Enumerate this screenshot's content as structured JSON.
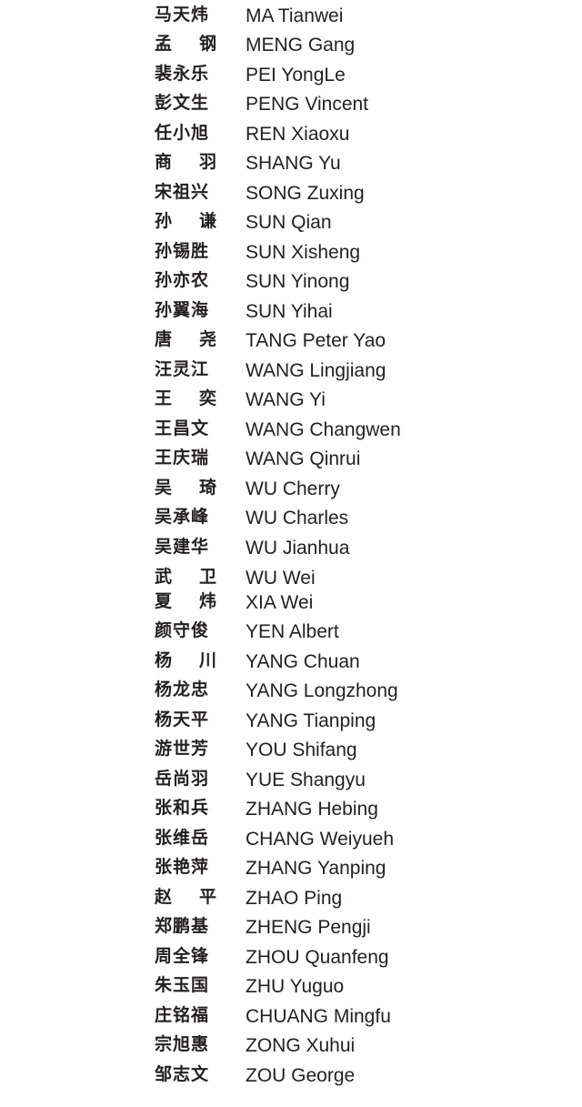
{
  "names": [
    {
      "cn": "马天炜",
      "en": "MA Tianwei"
    },
    {
      "cn": "孟 钢",
      "en": "MENG Gang"
    },
    {
      "cn": "裴永乐",
      "en": "PEI YongLe"
    },
    {
      "cn": "彭文生",
      "en": "PENG Vincent"
    },
    {
      "cn": "任小旭",
      "en": "REN Xiaoxu"
    },
    {
      "cn": "商 羽",
      "en": "SHANG Yu"
    },
    {
      "cn": "宋祖兴",
      "en": "SONG Zuxing"
    },
    {
      "cn": "孙 谦",
      "en": "SUN Qian"
    },
    {
      "cn": "孙锡胜",
      "en": "SUN Xisheng"
    },
    {
      "cn": "孙亦农",
      "en": "SUN Yinong"
    },
    {
      "cn": "孙翼海",
      "en": "SUN Yihai"
    },
    {
      "cn": "唐 尧",
      "en": "TANG Peter Yao"
    },
    {
      "cn": "汪灵江",
      "en": "WANG Lingjiang"
    },
    {
      "cn": "王 奕",
      "en": "WANG Yi"
    },
    {
      "cn": "王昌文",
      "en": "WANG Changwen"
    },
    {
      "cn": "王庆瑞",
      "en": "WANG Qinrui"
    },
    {
      "cn": "吴 琦",
      "en": "WU Cherry"
    },
    {
      "cn": "吴承峰",
      "en": "WU Charles"
    },
    {
      "cn": "吴建华",
      "en": "WU Jianhua"
    },
    {
      "cn": "武 卫",
      "en": "WU Wei"
    },
    {
      "cn": "夏 炜",
      "en": "XIA Wei"
    },
    {
      "cn": "颜守俊",
      "en": "YEN Albert"
    },
    {
      "cn": "杨 川",
      "en": "YANG Chuan"
    },
    {
      "cn": "杨龙忠",
      "en": "YANG Longzhong"
    },
    {
      "cn": "杨天平",
      "en": "YANG Tianping"
    },
    {
      "cn": "游世芳",
      "en": "YOU Shifang"
    },
    {
      "cn": "岳尚羽",
      "en": "YUE Shangyu"
    },
    {
      "cn": "张和兵",
      "en": "ZHANG Hebing"
    },
    {
      "cn": "张维岳",
      "en": "CHANG Weiyueh"
    },
    {
      "cn": "张艳萍",
      "en": "ZHANG Yanping"
    },
    {
      "cn": "赵 平",
      "en": "ZHAO Ping"
    },
    {
      "cn": "郑鹏基",
      "en": "ZHENG Pengji"
    },
    {
      "cn": "周全锋",
      "en": "ZHOU Quanfeng"
    },
    {
      "cn": "朱玉国",
      "en": "ZHU Yuguo"
    },
    {
      "cn": "庄铭福",
      "en": "CHUANG Mingfu"
    },
    {
      "cn": "宗旭惠",
      "en": "ZONG Xuhui"
    },
    {
      "cn": "邹志文",
      "en": "ZOU George"
    }
  ]
}
